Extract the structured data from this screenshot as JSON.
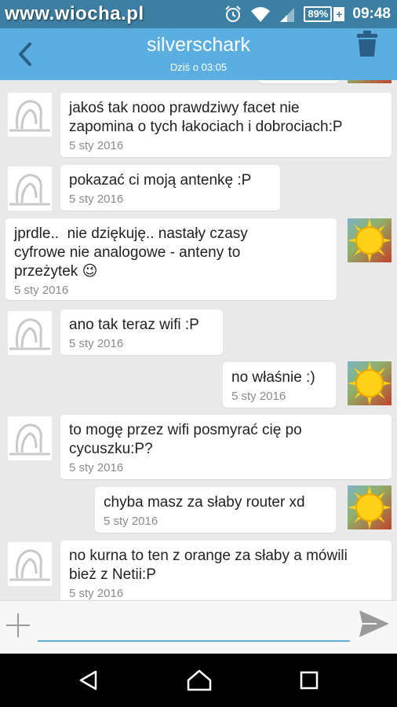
{
  "status_bar": {
    "watermark": "www.wiocha.pl",
    "battery": "89%",
    "battery_plus": "+",
    "time": "09:48",
    "icons": [
      "alarm-icon",
      "wifi-icon",
      "signal-icon",
      "battery-icon"
    ]
  },
  "header": {
    "title": "silverschark",
    "subtitle": "Dziś o 03:05"
  },
  "messages": [
    {
      "side": "left",
      "text": "jakoś tak nooo prawdziwy facet nie\nzapomina o tych łakociach i dobrociach:P",
      "date": "5 sty 2016"
    },
    {
      "side": "left",
      "text": "pokazać ci moją antenkę :P",
      "date": "5 sty 2016"
    },
    {
      "side": "right",
      "text": "jprdle..  nie dziękuję.. nastały czasy\ncyfrowe nie analogowe - anteny to\nprzeżytek",
      "emoji": "😉",
      "date": "5 sty 2016"
    },
    {
      "side": "left",
      "text": "ano tak teraz wifi :P",
      "date": "5 sty 2016"
    },
    {
      "side": "right",
      "text": "no właśnie :)",
      "date": "5 sty 2016"
    },
    {
      "side": "left",
      "text": "to mogę przez wifi posmyrać cię po\ncycuszku:P?",
      "date": "5 sty 2016"
    },
    {
      "side": "right",
      "text": "chyba masz za słaby router xd",
      "date": "5 sty 2016"
    },
    {
      "side": "left",
      "text": "no kurna to ten z orange za słaby a mówili\nbież z Netii:P",
      "date": "5 sty 2016"
    }
  ],
  "input": {
    "value": "",
    "placeholder": ""
  },
  "colors": {
    "status_bar": "#3d7fa3",
    "header": "#5aaee0",
    "chat_background": "#e9e9e9",
    "bubble": "#ffffff",
    "accent": "#5aaee0"
  }
}
